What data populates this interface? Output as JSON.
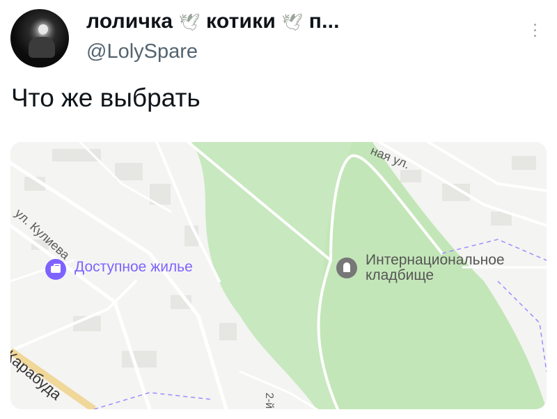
{
  "tweet": {
    "display_name_parts": [
      "лоличка",
      "котики",
      "п..."
    ],
    "dove_emoji": "🕊",
    "handle": "@LolySpare",
    "text": "Что же выбрать",
    "more_icon": "more-vertical-icon",
    "avatar_icon": "user-avatar"
  },
  "map": {
    "poi_housing": {
      "label": "Доступное жилье",
      "icon": "briefcase-icon",
      "color": "#7e63ff"
    },
    "poi_cemetery": {
      "label_line1": "Интернациональное",
      "label_line2": "кладбище",
      "icon": "tombstone-icon",
      "color": "#777777"
    },
    "streets": {
      "kulieva": "ул. Кулиева",
      "top_right": "ная ул.",
      "bottom_left": "Карабуда",
      "bottom_mid": "2-й"
    },
    "colors": {
      "park": "#c3e6b8",
      "road": "#ffffff",
      "ground": "#f4f4f2"
    }
  }
}
